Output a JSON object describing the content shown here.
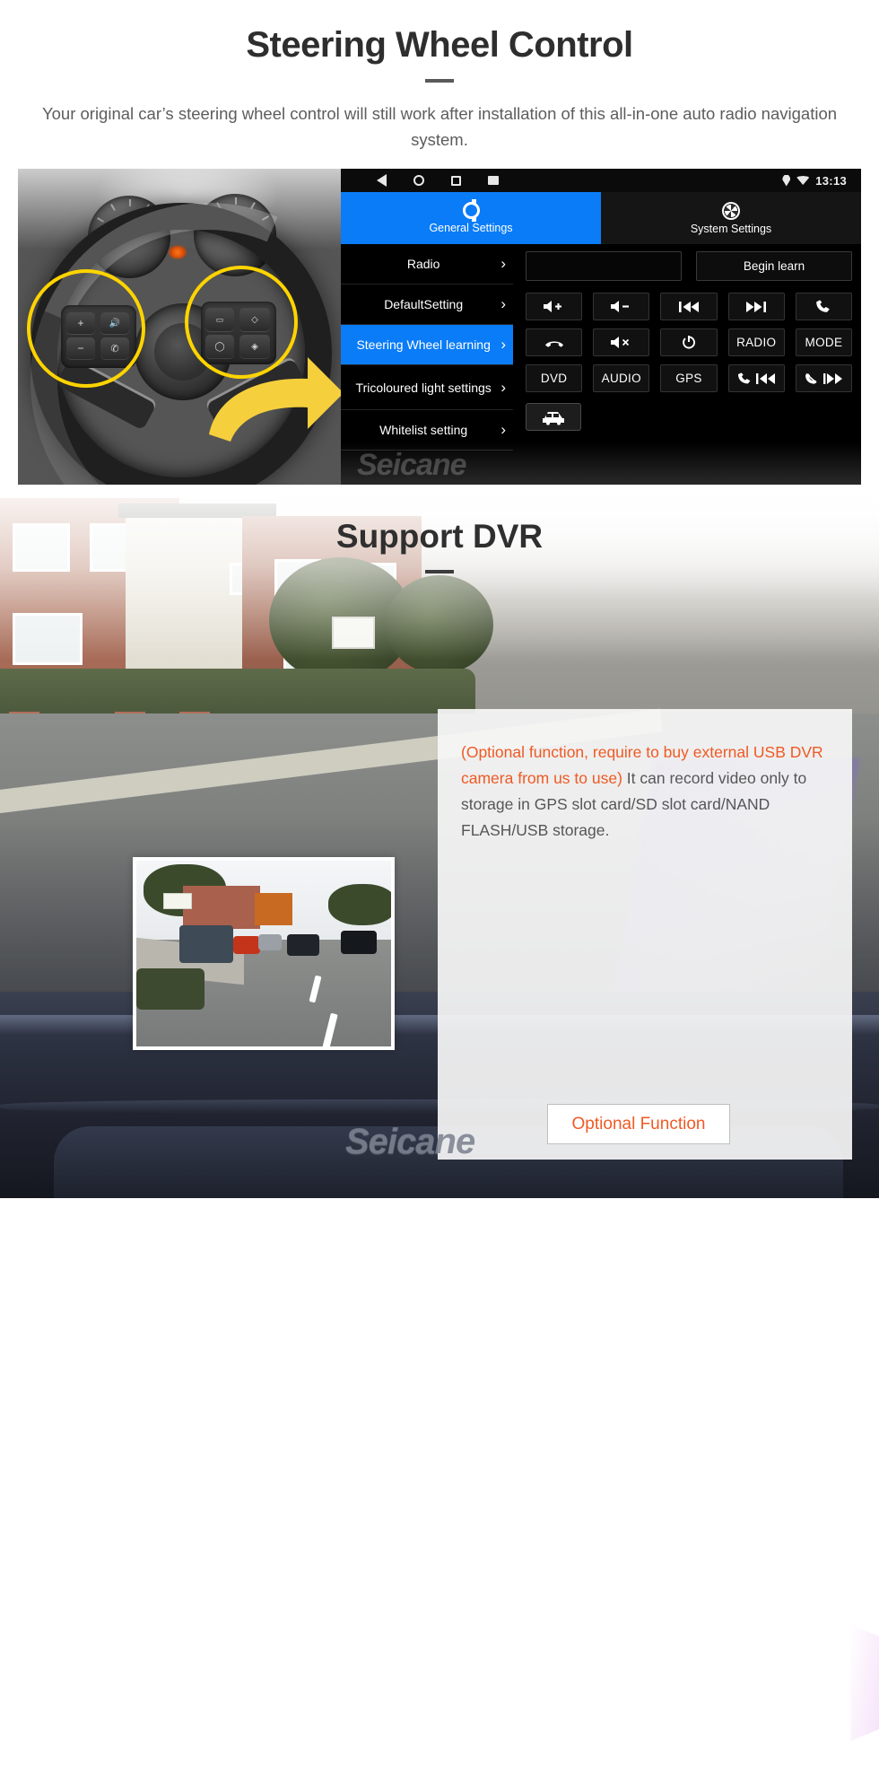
{
  "section1": {
    "title": "Steering Wheel Control",
    "subtitle": "Your original car’s steering wheel control will still work after installation of this all-in-one auto radio navigation system.",
    "unit": {
      "statusbar": {
        "back_icon": "back-triangle-icon",
        "home_icon": "home-circle-icon",
        "recents_icon": "recents-square-icon",
        "screenshot_icon": "screenshot-icon",
        "gps_icon": "gps-pin-icon",
        "wifi_icon": "wifi-icon",
        "time": "13:13"
      },
      "tabs": [
        {
          "label": "General Settings",
          "icon": "gear-icon",
          "active": true
        },
        {
          "label": "System Settings",
          "icon": "system-settings-icon",
          "active": false
        }
      ],
      "menu": [
        {
          "label": "Radio",
          "active": false
        },
        {
          "label": "DefaultSetting",
          "active": false
        },
        {
          "label": "Steering Wheel learning",
          "active": true
        },
        {
          "label": "Tricoloured light settings",
          "active": false
        },
        {
          "label": "Whitelist setting",
          "active": false
        }
      ],
      "chevron": "›",
      "input_value": "",
      "begin_learn_label": "Begin learn",
      "buttons": [
        {
          "label": "",
          "icon": "volume-up-icon"
        },
        {
          "label": "",
          "icon": "volume-down-icon"
        },
        {
          "label": "",
          "icon": "previous-track-icon"
        },
        {
          "label": "",
          "icon": "next-track-icon"
        },
        {
          "label": "",
          "icon": "phone-answer-icon"
        },
        {
          "label": "",
          "icon": "phone-hangup-icon"
        },
        {
          "label": "",
          "icon": "mute-icon"
        },
        {
          "label": "",
          "icon": "power-icon"
        },
        {
          "label": "RADIO",
          "icon": ""
        },
        {
          "label": "MODE",
          "icon": ""
        },
        {
          "label": "DVD",
          "icon": ""
        },
        {
          "label": "AUDIO",
          "icon": ""
        },
        {
          "label": "GPS",
          "icon": ""
        },
        {
          "label": "",
          "icon": "phone-previous-icon"
        },
        {
          "label": "",
          "icon": "phone-reject-next-icon"
        }
      ],
      "car_button_icon": "car-icon",
      "watermark": "Seicane"
    }
  },
  "section2": {
    "title": "Support DVR",
    "card": {
      "highlight_text": "(Optional function, require to buy external USB DVR camera from us to use)",
      "body_text": "It can record video only to storage in GPS slot card/SD slot card/NAND FLASH/USB storage.",
      "button_label": "Optional Function"
    },
    "watermark": "Seicane",
    "device_icon": "usb-dvr-camera",
    "inset_icon": "dashcam-video-preview"
  },
  "colors": {
    "accent_blue": "#0a7cf7",
    "accent_orange": "#ef5a24",
    "highlight_yellow": "#ffd400",
    "heading_dark": "#2e2e2e",
    "body_grey": "#5d5d5d"
  }
}
